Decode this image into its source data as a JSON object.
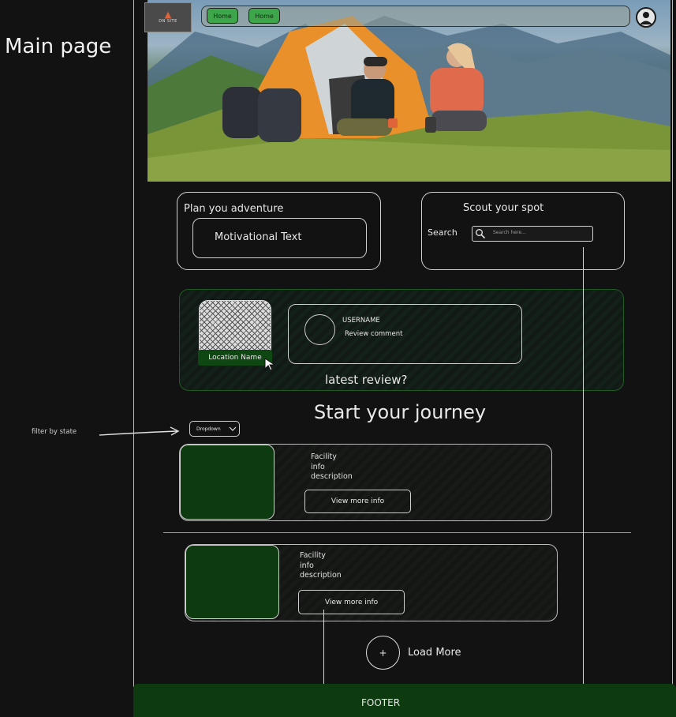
{
  "annotations": {
    "page_label": "Main page",
    "filter_note": "filter by state"
  },
  "header": {
    "logo_text": "DN SITE",
    "nav": [
      {
        "label": "Home"
      },
      {
        "label": "Home"
      }
    ]
  },
  "plan": {
    "title": "Plan you adventure",
    "motivational": "Motivational Text"
  },
  "scout": {
    "title": "Scout your spot",
    "search_label": "Search",
    "search_placeholder": "Search here..."
  },
  "review": {
    "location_name": "Location Name",
    "username": "USERNAME",
    "comment": "Review comment",
    "caption": "latest review?"
  },
  "journey": {
    "title": "Start your journey",
    "dropdown_label": "Dropdown"
  },
  "facilities": [
    {
      "lines": [
        "Facility",
        "info",
        "description"
      ],
      "button": "View more info"
    },
    {
      "lines": [
        "Facility",
        "info",
        "description"
      ],
      "button": "View more info"
    }
  ],
  "load_more": {
    "icon": "+",
    "label": "Load More"
  },
  "footer": {
    "label": "FOOTER"
  },
  "colors": {
    "background": "#121212",
    "accent_green": "#0e3a10",
    "nav_green": "#3ea64a"
  }
}
